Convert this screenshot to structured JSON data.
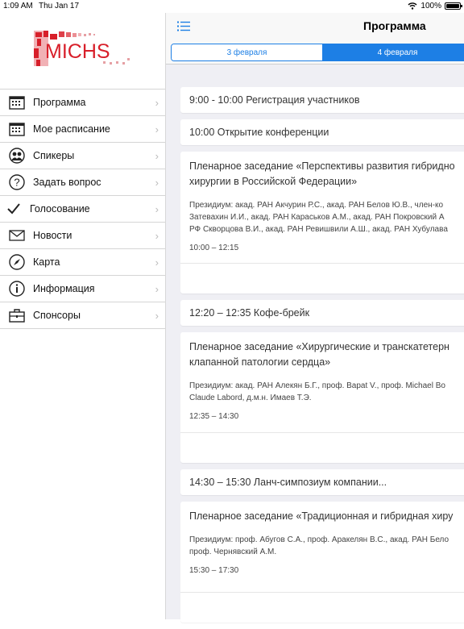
{
  "status": {
    "time": "1:09 AM",
    "date": "Thu Jan 17",
    "battery": "100%",
    "battery_level": 1.0
  },
  "logo": {
    "text": "MICHS"
  },
  "sidebar": {
    "items": [
      {
        "label": "Программа",
        "icon": "calendar-icon"
      },
      {
        "label": "Мое расписание",
        "icon": "calendar-icon"
      },
      {
        "label": "Спикеры",
        "icon": "speakers-icon"
      },
      {
        "label": "Задать вопрос",
        "icon": "question-icon"
      },
      {
        "label": "Голосование",
        "icon": "checkmark-icon"
      },
      {
        "label": "Новости",
        "icon": "envelope-icon"
      },
      {
        "label": "Карта",
        "icon": "compass-icon"
      },
      {
        "label": "Информация",
        "icon": "info-icon"
      },
      {
        "label": "Спонсоры",
        "icon": "briefcase-icon"
      }
    ]
  },
  "header": {
    "title": "Программа"
  },
  "days": {
    "day1": "3 февраля",
    "day2": "4 февраля",
    "selected": "4 февраля"
  },
  "events": {
    "e1": "9:00 - 10:00 Регистрация участников",
    "e2": "10:00 Открытие конференции",
    "e3": {
      "title_1": "Пленарное заседание «Перспективы развития гибридно",
      "title_2": "хирургии в Российской Федерации»",
      "presidium_1": "Президиум: акад. РАН Акчурин Р.С., акад. РАН Белов Ю.В., член-ко",
      "presidium_2": "Затевахин И.И., акад. РАН Караськов А.М., акад. РАН Покровский А",
      "presidium_3": "РФ Скворцова В.И., акад. РАН Ревишвили А.Ш., акад. РАН Хубулава",
      "time": "10:00 – 12:15"
    },
    "e4": "12:20 – 12:35 Кофе-брейк",
    "e5": {
      "title_1": "Пленарное заседание «Хирургические и транскатетерн",
      "title_2": "клапанной патологии сердца»",
      "presidium_1": "Президиум: акад. РАН Алекян Б.Г., проф. Bapat V., проф. Michael Bo",
      "presidium_2": "Claude Labord, д.м.н. Имаев Т.Э.",
      "time": "12:35 – 14:30"
    },
    "e6": "14:30 – 15:30 Ланч-симпозиум компании...",
    "e7": {
      "title_1": "Пленарное заседание «Традиционная и гибридная хиру",
      "presidium_1": "Президиум: проф. Абугов С.А., проф. Аракелян В.С., акад. РАН Бело",
      "presidium_2": "проф. Чернявский А.М.",
      "time": "15:30 – 17:30"
    }
  },
  "colors": {
    "accent": "#1d7fe5",
    "logo_red": "#d81f2a",
    "background": "#efeff4"
  }
}
